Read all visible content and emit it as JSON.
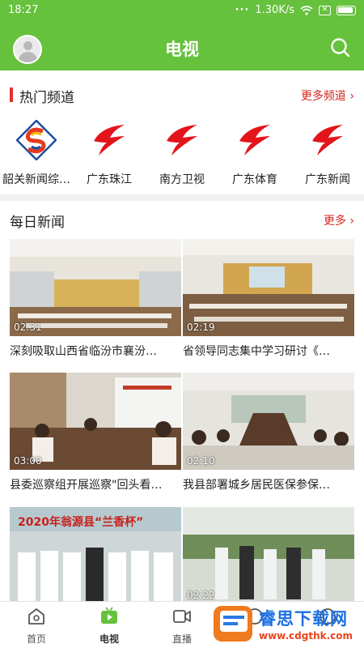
{
  "status_bar": {
    "time": "18:27",
    "net_speed": "1.30K/s",
    "x_badge": "✕"
  },
  "header": {
    "title": "电视"
  },
  "hot_channels": {
    "title": "热门频道",
    "more": "更多频道 ›",
    "items": [
      {
        "name": "韶关新闻综…",
        "icon": "shaoguan-logo"
      },
      {
        "name": "广东珠江",
        "icon": "guangdong-logo"
      },
      {
        "name": "南方卫视",
        "icon": "guangdong-logo"
      },
      {
        "name": "广东体育",
        "icon": "guangdong-logo"
      },
      {
        "name": "广东新闻",
        "icon": "guangdong-logo"
      }
    ]
  },
  "daily_news": {
    "title": "每日新闻",
    "more": "更多 ›",
    "items": [
      {
        "duration": "02:31",
        "caption": "深刻吸取山西省临汾市襄汾…"
      },
      {
        "duration": "02:19",
        "caption": "省领导同志集中学习研讨《…"
      },
      {
        "duration": "03:00",
        "caption": "县委巡察组开展巡察\"回头看…"
      },
      {
        "duration": "02:10",
        "caption": "我县部署城乡居民医保参保…"
      },
      {
        "duration": "",
        "caption": ""
      },
      {
        "duration": "02:22",
        "caption": ""
      }
    ],
    "banner_text": "2020年翁源县“兰香杯”"
  },
  "bottom_nav": [
    {
      "label": "首页",
      "icon": "home-icon"
    },
    {
      "label": "电视",
      "icon": "tv-icon"
    },
    {
      "label": "直播",
      "icon": "live-icon"
    },
    {
      "label": "",
      "icon": "radio-icon"
    },
    {
      "label": "",
      "icon": "mine-icon"
    }
  ],
  "watermark": {
    "title": "睿思下载网",
    "url": "www.cdgthk.com"
  },
  "colors": {
    "brand_green": "#66c13d",
    "accent_red": "#d6261e"
  }
}
